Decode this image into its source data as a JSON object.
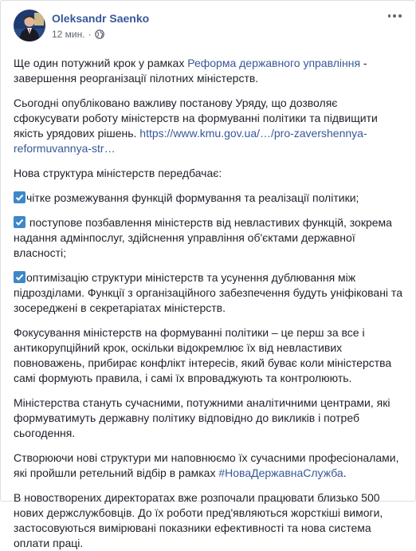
{
  "post": {
    "author": "Oleksandr Saenko",
    "time": "12 мин.",
    "separator": "·",
    "privacy_icon": "globe-icon",
    "more_icon": "more-options-icon",
    "link_color": "#385898"
  },
  "body": {
    "p1_a": "Ще один потужний крок у рамках ",
    "p1_link": "Реформа державного управління",
    "p1_b": " - завершення реорганізації пілотних міністерств.",
    "p2_a": "Сьогодні опубліковано важливу постанову Уряду, що дозволяє сфокусувати роботу міністерств на формуванні політики та підвищити якість урядових рішень. ",
    "p2_link": "https://www.kmu.gov.ua/…/pro-zavershennya-reformuvannya-str…",
    "p3": "Нова структура міністерств передбачає:",
    "p4": "чітке розмежування функцій формування та реалізації політики;",
    "p5": " поступове позбавлення міністерств від невластивих функцій, зокрема надання адмінпослуг, здійснення управління об'єктами державної власності;",
    "p6": "оптимізацію структури міністерств та усунення дублювання між підрозділами. Функції з організаційного забезпечення будуть уніфіковані та зосереджені в секретаріатах міністерств.",
    "p7": "Фокусування міністерств на формуванні політики – це перш за все і антикорупційний крок, оскільки відокремлює їх від невластивих повноважень, прибирає конфлікт інтересів, який буває коли міністерства самі формують правила, і самі їх впроваджують та контролюють.",
    "p8": "Міністерства стануть сучасними, потужними аналітичними центрами, які формуватимуть державну політику відповідно до викликів і потреб сьогодення.",
    "p9_a": "Створюючи нові структури ми наповнюємо їх сучасними професіоналами, які пройшли ретельний відбір в рамках ",
    "p9_link": "#НоваДержавнаСлужба",
    "p9_b": ".",
    "p10": "В новостворених директоратах вже розпочали працювати близько 500 нових держслужбовців. До їх роботи пред'являються жорсткіші вимоги, застосовуються вимірювані показники ефективності та нова система оплати праці."
  }
}
